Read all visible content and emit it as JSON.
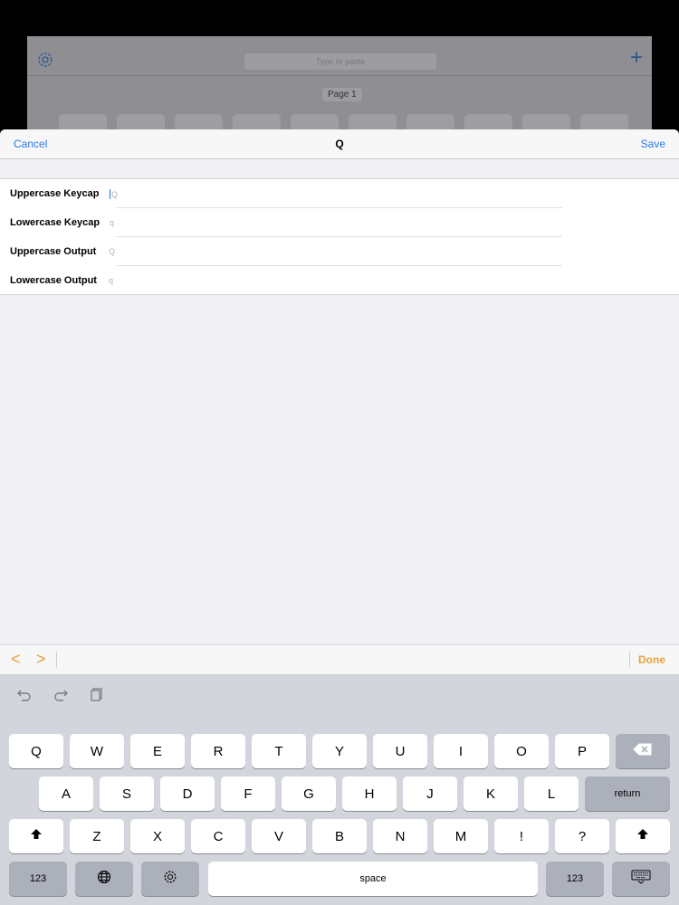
{
  "background": {
    "search_placeholder": "Type or paste",
    "page_label": "Page 1"
  },
  "nav": {
    "cancel": "Cancel",
    "title": "Q",
    "save": "Save"
  },
  "fields": [
    {
      "label": "Uppercase Keycap",
      "value": "Q"
    },
    {
      "label": "Lowercase Keycap",
      "value": "q"
    },
    {
      "label": "Uppercase Output",
      "value": "Q"
    },
    {
      "label": "Lowercase Output",
      "value": "q"
    }
  ],
  "accessory": {
    "prev": "<",
    "next": ">",
    "done": "Done"
  },
  "keyboard": {
    "row1": [
      "Q",
      "W",
      "E",
      "R",
      "T",
      "Y",
      "U",
      "I",
      "O",
      "P"
    ],
    "row2": [
      "A",
      "S",
      "D",
      "F",
      "G",
      "H",
      "J",
      "K",
      "L"
    ],
    "return": "return",
    "row3": [
      "Z",
      "X",
      "C",
      "V",
      "B",
      "N",
      "M",
      "!",
      "?"
    ],
    "numbers_left": "123",
    "space": "space",
    "numbers_right": "123"
  },
  "colors": {
    "accent_blue": "#2a7ae2",
    "accent_orange": "#e8a03c"
  }
}
